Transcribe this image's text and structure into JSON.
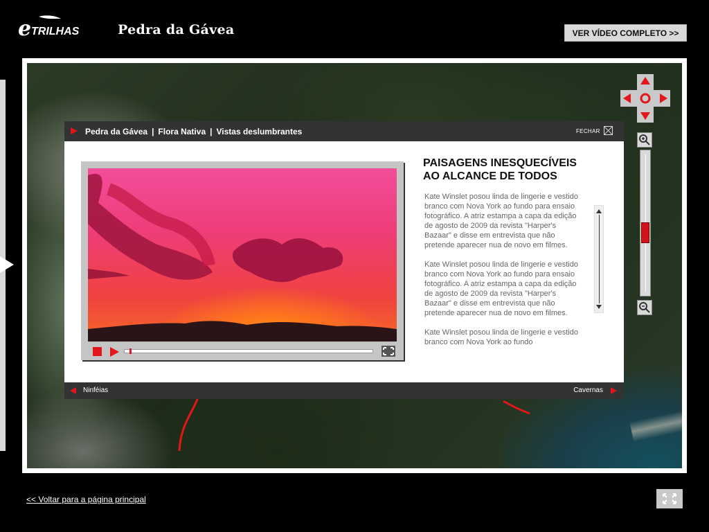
{
  "header": {
    "logo_text": "eTRILHAS",
    "title": "Pedra da Gávea",
    "video_button": "VER VÍDEO COMPLETO >>"
  },
  "modal": {
    "breadcrumb": [
      "Pedra da Gávea",
      "Flora Nativa",
      "Vistas deslumbrantes"
    ],
    "breadcrumb_separator": "|",
    "close_label": "FECHAR",
    "article_title_line1": "PAISAGENS INESQUECÍVEIS",
    "article_title_line2": "AO ALCANCE DE TODOS",
    "paragraphs": [
      "Kate Winslet posou linda de lingerie e vestido branco com Nova York ao fundo para ensaio fotográfico. A atriz estampa a capa da edição de agosto de 2009 da revista \"Harper's Bazaar\" e disse em entrevista que não pretende aparecer nua de novo em filmes.",
      "Kate Winslet posou linda de lingerie e vestido branco com Nova York ao fundo para ensaio fotográfico. A atriz estampa a capa da edição de agosto de 2009 da revista \"Harper's Bazaar\" e disse em entrevista que não pretende aparecer nua de novo em filmes.",
      "Kate Winslet posou linda de lingerie e vestido branco com Nova York ao fundo"
    ],
    "prev_label": "Ninféias",
    "next_label": "Cavernas"
  },
  "player": {
    "progress_fraction": 0.02
  },
  "footer": {
    "back_link": "<< Voltar para a página principal"
  },
  "icons": {
    "pan": "dpad-icon",
    "zoom_in": "zoom-in-icon",
    "zoom_out": "zoom-out-icon",
    "close": "close-icon",
    "fullscreen": "fullscreen-icon"
  },
  "colors": {
    "accent": "#e3161c",
    "bar": "#333333",
    "panel_gray": "#d9d9d9"
  },
  "zoom_level_fraction": 0.42
}
